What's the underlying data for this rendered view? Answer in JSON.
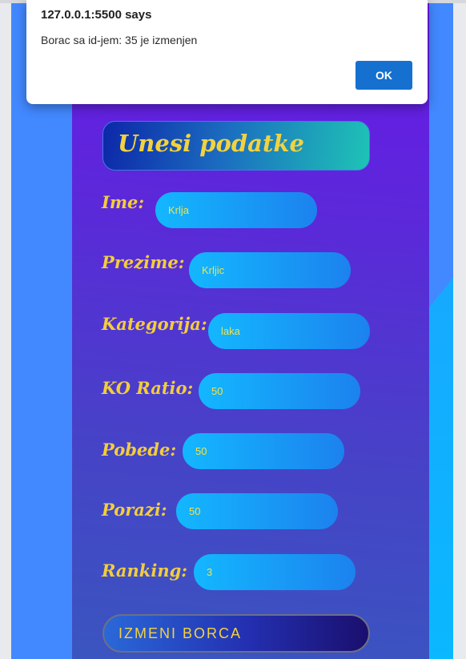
{
  "dialog": {
    "title": "127.0.0.1:5500 says",
    "message": "Borac sa id-jem: 35 je izmenjen",
    "ok_label": "OK"
  },
  "form": {
    "heading": "Unesi podatke",
    "fields": [
      {
        "label": "Ime:",
        "value": "Krlja"
      },
      {
        "label": "Prezime:",
        "value": "Krljic"
      },
      {
        "label": "Kategorija:",
        "value": "laka"
      },
      {
        "label": "KO Ratio:",
        "value": "50"
      },
      {
        "label": "Pobede:",
        "value": "50"
      },
      {
        "label": "Porazi:",
        "value": "50"
      },
      {
        "label": "Ranking:",
        "value": "3"
      }
    ],
    "submit_label": "IZMENI BORCA"
  },
  "colors": {
    "accent_text": "#f3d23f",
    "page_background": "#4288ff",
    "panel_top": "#6a17e8",
    "input_fill": "#13b7ff",
    "ok_button": "#1570cf"
  }
}
